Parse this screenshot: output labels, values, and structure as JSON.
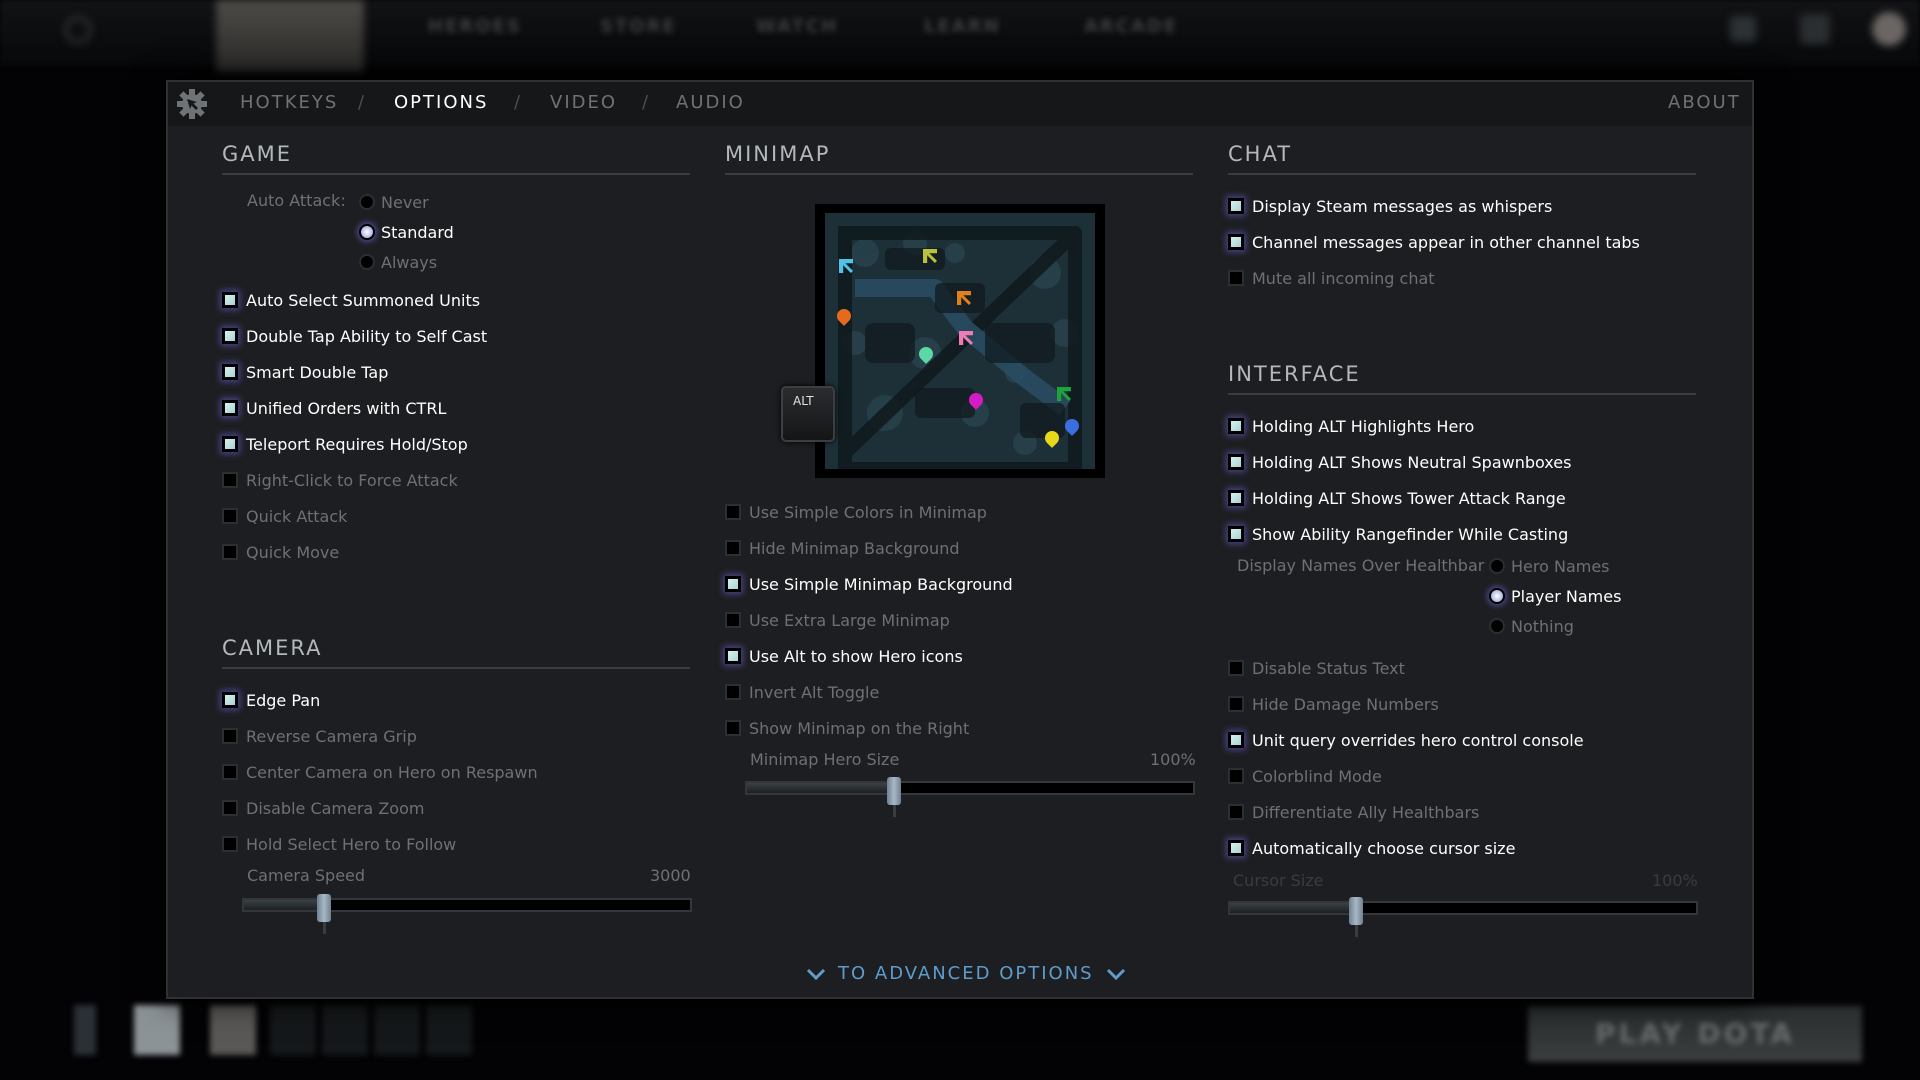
{
  "background": {
    "nav_items": [
      "HEROES",
      "STORE",
      "WATCH",
      "LEARN",
      "ARCADE"
    ],
    "play_button": "PLAY DOTA"
  },
  "header": {
    "tabs": [
      {
        "label": "HOTKEYS",
        "active": false
      },
      {
        "label": "OPTIONS",
        "active": true
      },
      {
        "label": "VIDEO",
        "active": false
      },
      {
        "label": "AUDIO",
        "active": false
      }
    ],
    "separator": "/",
    "about": "ABOUT",
    "gear_icon": "gear-icon"
  },
  "game": {
    "title": "GAME",
    "auto_attack": {
      "label": "Auto Attack:",
      "options": [
        {
          "label": "Never",
          "selected": false
        },
        {
          "label": "Standard",
          "selected": true
        },
        {
          "label": "Always",
          "selected": false
        }
      ]
    },
    "checkboxes": [
      {
        "label": "Auto Select Summoned Units",
        "checked": true
      },
      {
        "label": "Double Tap Ability to Self Cast",
        "checked": true
      },
      {
        "label": "Smart Double Tap",
        "checked": true
      },
      {
        "label": "Unified Orders with CTRL",
        "checked": true
      },
      {
        "label": "Teleport Requires Hold/Stop",
        "checked": true
      },
      {
        "label": "Right-Click to Force Attack",
        "checked": false
      },
      {
        "label": "Quick Attack",
        "checked": false
      },
      {
        "label": "Quick Move",
        "checked": false
      }
    ]
  },
  "camera": {
    "title": "CAMERA",
    "checkboxes": [
      {
        "label": "Edge Pan",
        "checked": true
      },
      {
        "label": "Reverse Camera Grip",
        "checked": false
      },
      {
        "label": "Center Camera on Hero on Respawn",
        "checked": false
      },
      {
        "label": "Disable Camera Zoom",
        "checked": false
      },
      {
        "label": "Hold Select Hero to Follow",
        "checked": false
      }
    ],
    "speed": {
      "label": "Camera Speed",
      "value_text": "3000",
      "fraction": 0.18
    }
  },
  "minimap": {
    "title": "MINIMAP",
    "alt_key": "ALT",
    "checkboxes": [
      {
        "label": "Use Simple Colors in Minimap",
        "checked": false
      },
      {
        "label": "Hide Minimap Background",
        "checked": false
      },
      {
        "label": "Use Simple Minimap Background",
        "checked": true
      },
      {
        "label": "Use Extra Large Minimap",
        "checked": false
      },
      {
        "label": "Use Alt to show Hero icons",
        "checked": true
      },
      {
        "label": "Invert Alt Toggle",
        "checked": false
      },
      {
        "label": "Show Minimap on the Right",
        "checked": false
      }
    ],
    "hero_size": {
      "label": "Minimap Hero Size",
      "value_text": "100%",
      "fraction": 0.33
    },
    "hero_markers": [
      {
        "color": "#4fc3e8",
        "shape": "arrow"
      },
      {
        "color": "#b9c23a",
        "shape": "arrow"
      },
      {
        "color": "#e0801a",
        "shape": "arrow"
      },
      {
        "color": "#e66a1c",
        "shape": "drop"
      },
      {
        "color": "#f07bb5",
        "shape": "arrow"
      },
      {
        "color": "#5cd8a8",
        "shape": "drop"
      },
      {
        "color": "#d31cc4",
        "shape": "drop"
      },
      {
        "color": "#1ea33a",
        "shape": "arrow"
      },
      {
        "color": "#3b6fe0",
        "shape": "drop"
      },
      {
        "color": "#e8d81a",
        "shape": "drop"
      }
    ]
  },
  "chat": {
    "title": "CHAT",
    "checkboxes": [
      {
        "label": "Display Steam messages as whispers",
        "checked": true
      },
      {
        "label": "Channel messages appear in other channel tabs",
        "checked": true
      },
      {
        "label": "Mute all incoming chat",
        "checked": false
      }
    ]
  },
  "interface": {
    "title": "INTERFACE",
    "checkboxes_top": [
      {
        "label": "Holding ALT Highlights Hero",
        "checked": true
      },
      {
        "label": "Holding ALT Shows Neutral Spawnboxes",
        "checked": true
      },
      {
        "label": "Holding ALT Shows Tower Attack Range",
        "checked": true
      },
      {
        "label": "Show Ability Rangefinder While Casting",
        "checked": true
      }
    ],
    "display_names": {
      "label": "Display Names Over Healthbar",
      "options": [
        {
          "label": "Hero Names",
          "selected": false
        },
        {
          "label": "Player Names",
          "selected": true
        },
        {
          "label": "Nothing",
          "selected": false
        }
      ]
    },
    "checkboxes_bottom": [
      {
        "label": "Disable Status Text",
        "checked": false
      },
      {
        "label": "Hide Damage Numbers",
        "checked": false
      },
      {
        "label": "Unit query overrides hero control console",
        "checked": true
      },
      {
        "label": "Colorblind Mode",
        "checked": false
      },
      {
        "label": "Differentiate Ally Healthbars",
        "checked": false
      },
      {
        "label": "Automatically choose cursor size",
        "checked": true
      }
    ],
    "cursor_size": {
      "label": "Cursor Size",
      "value_text": "100%",
      "fraction": 0.27,
      "disabled": true
    }
  },
  "advanced_link": "TO ADVANCED OPTIONS"
}
